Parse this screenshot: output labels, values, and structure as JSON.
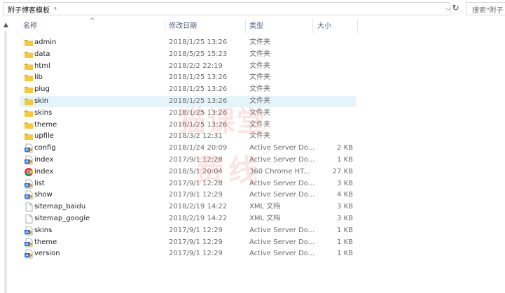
{
  "address": {
    "path": "附子博客模板",
    "separator": "›",
    "dropdown": "⌵",
    "refresh": "↻"
  },
  "search": {
    "placeholder": "搜索\"附子"
  },
  "columns": {
    "name": "名称",
    "date": "修改日期",
    "type": "类型",
    "size": "大小"
  },
  "files": [
    {
      "name": "admin",
      "date": "2018/1/25 13:26",
      "type": "文件夹",
      "size": "",
      "icon": "folder-icon",
      "selected": false
    },
    {
      "name": "data",
      "date": "2018/5/25 15:23",
      "type": "文件夹",
      "size": "",
      "icon": "folder-icon",
      "selected": false
    },
    {
      "name": "html",
      "date": "2018/2/2 22:19",
      "type": "文件夹",
      "size": "",
      "icon": "folder-icon",
      "selected": false
    },
    {
      "name": "lib",
      "date": "2018/1/25 13:26",
      "type": "文件夹",
      "size": "",
      "icon": "folder-icon",
      "selected": false
    },
    {
      "name": "plug",
      "date": "2018/1/25 13:26",
      "type": "文件夹",
      "size": "",
      "icon": "folder-icon",
      "selected": false
    },
    {
      "name": "skin",
      "date": "2018/1/25 13:26",
      "type": "文件夹",
      "size": "",
      "icon": "folder-icon",
      "selected": true
    },
    {
      "name": "skins",
      "date": "2018/1/25 13:26",
      "type": "文件夹",
      "size": "",
      "icon": "folder-icon",
      "selected": false
    },
    {
      "name": "theme",
      "date": "2018/1/25 13:26",
      "type": "文件夹",
      "size": "",
      "icon": "folder-icon",
      "selected": false
    },
    {
      "name": "upfile",
      "date": "2018/3/2 12:31",
      "type": "文件夹",
      "size": "",
      "icon": "folder-icon",
      "selected": false
    },
    {
      "name": "config",
      "date": "2018/1/24 20:09",
      "type": "Active Server Do...",
      "size": "2 KB",
      "icon": "asp-file-icon",
      "selected": false
    },
    {
      "name": "index",
      "date": "2017/9/1 12:28",
      "type": "Active Server Do...",
      "size": "1 KB",
      "icon": "asp-file-icon",
      "selected": false
    },
    {
      "name": "index",
      "date": "2018/5/1 20:04",
      "type": "360 Chrome HT...",
      "size": "27 KB",
      "icon": "chrome-html-icon",
      "selected": false
    },
    {
      "name": "list",
      "date": "2017/9/1 12:28",
      "type": "Active Server Do...",
      "size": "3 KB",
      "icon": "asp-file-icon",
      "selected": false
    },
    {
      "name": "show",
      "date": "2017/9/1 12:29",
      "type": "Active Server Do...",
      "size": "4 KB",
      "icon": "asp-file-icon",
      "selected": false
    },
    {
      "name": "sitemap_baidu",
      "date": "2018/2/19 14:22",
      "type": "XML 文档",
      "size": "3 KB",
      "icon": "xml-file-icon",
      "selected": false
    },
    {
      "name": "sitemap_google",
      "date": "2018/2/19 14:22",
      "type": "XML 文档",
      "size": "3 KB",
      "icon": "xml-file-icon",
      "selected": false
    },
    {
      "name": "skins",
      "date": "2017/9/1 12:29",
      "type": "Active Server Do...",
      "size": "1 KB",
      "icon": "asp-file-icon",
      "selected": false
    },
    {
      "name": "theme",
      "date": "2017/9/1 12:29",
      "type": "Active Server Do...",
      "size": "1 KB",
      "icon": "asp-file-icon",
      "selected": false
    },
    {
      "name": "version",
      "date": "2017/9/1 12:29",
      "type": "Active Server Do...",
      "size": "1 KB",
      "icon": "asp-file-icon",
      "selected": false
    }
  ],
  "watermark": {
    "line1": "猫课堂",
    "line2": "费线"
  },
  "colors": {
    "folder": "#f5c842",
    "folder_dark": "#dcaa2a",
    "selected_row": "#e5f3fb",
    "header_text": "#4c607a",
    "asp_blue": "#2e6bd3"
  }
}
